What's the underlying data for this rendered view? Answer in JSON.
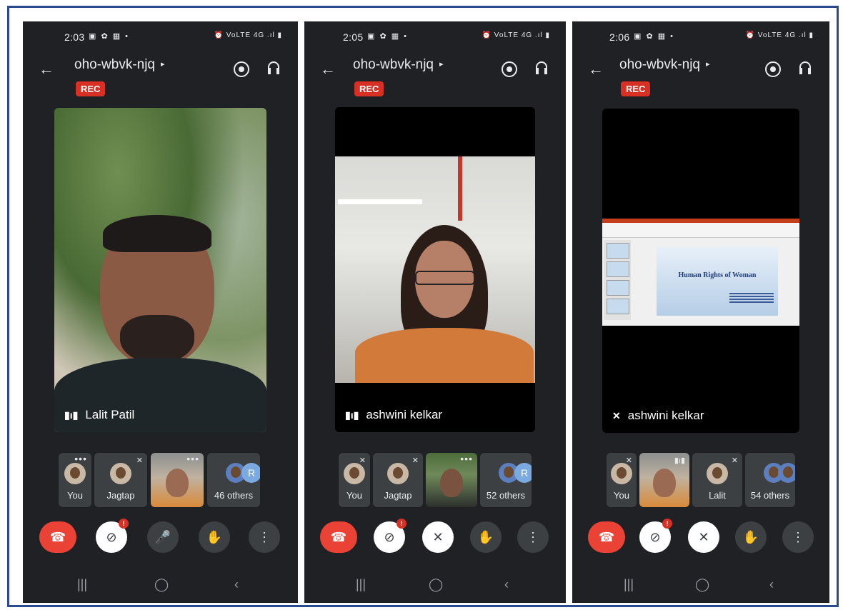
{
  "screens": [
    {
      "time": "2:03",
      "status_icons": "▣ ✿ ▦ •",
      "status_right": "⏰ VoLTE 4G .ıl ▮",
      "meeting_code": "oho-wbvk-njq",
      "rec": "REC",
      "main_speaker": "Lalit Patil",
      "tiles": [
        "You",
        "Jagtap",
        "",
        "46 others"
      ],
      "others_initial": "R"
    },
    {
      "time": "2:05",
      "status_icons": "▣ ✿ ▦ •",
      "status_right": "⏰ VoLTE 4G .ıl ▮",
      "meeting_code": "oho-wbvk-njq",
      "rec": "REC",
      "main_speaker": "ashwini kelkar",
      "tiles": [
        "You",
        "Jagtap",
        "",
        "52 others"
      ],
      "others_initial": "R"
    },
    {
      "time": "2:06",
      "status_icons": "▣ ✿ ▦ •",
      "status_right": "⏰ VoLTE 4G .ıl ▮",
      "meeting_code": "oho-wbvk-njq",
      "rec": "REC",
      "main_speaker": "ashwini kelkar",
      "tiles": [
        "You",
        "",
        "Lalit",
        "54 others"
      ],
      "slide_title": "Human Rights of Woman"
    }
  ],
  "controls": {
    "camera_badge": "!"
  },
  "icons": {
    "back": "←",
    "caret": "▸",
    "end": "☎",
    "camera_off": "⊘",
    "mic": "🎤",
    "mic_off": "✕",
    "hand": "✋",
    "more": "⋮",
    "nav_recents": "|||",
    "nav_home": "◯",
    "nav_back": "‹",
    "mute": "✕",
    "dots": "•••",
    "speaking": "▮ı▮"
  },
  "colors": {
    "rec": "#d93025",
    "end_call": "#ea4335",
    "frame_border": "#2b4a8f",
    "bg": "#202124"
  }
}
